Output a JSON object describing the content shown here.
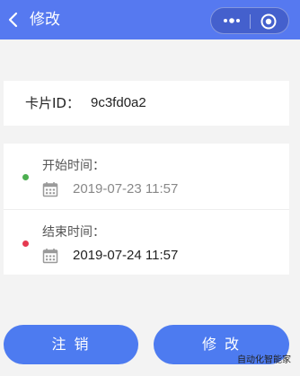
{
  "header": {
    "title": "修改",
    "back_icon": "chevron-left-icon",
    "menu": {
      "more_icon": "more-dots-icon",
      "close_icon": "target-circle-icon"
    },
    "background": "#5679f0"
  },
  "card": {
    "label": "卡片ID：",
    "value": "9c3fd0a2"
  },
  "times": {
    "start": {
      "label": "开始时间：",
      "value": "2019-07-23 11:57",
      "dot_color": "#4caf50",
      "value_color": "#888888"
    },
    "end": {
      "label": "结束时间：",
      "value": "2019-07-24 11:57",
      "dot_color": "#e53950",
      "value_color": "#222222"
    }
  },
  "buttons": {
    "cancel": "注 销",
    "modify": "修 改"
  },
  "watermark": "自动化智能家"
}
